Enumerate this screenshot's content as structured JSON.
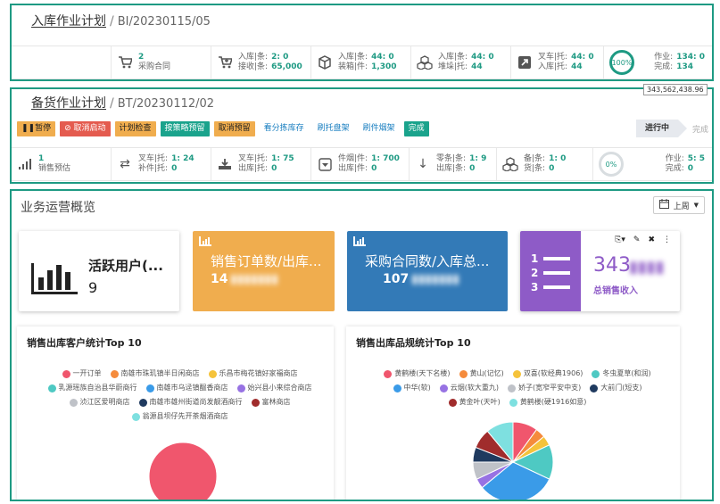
{
  "inbound": {
    "title": "入库作业计划",
    "code": "BI/20230115/05",
    "stats": [
      {
        "icon": "cart-icon",
        "lines": [
          {
            "label": "",
            "value": "2"
          },
          {
            "label": "采购合同",
            "value": ""
          }
        ]
      },
      {
        "icon": "cart-plus-icon",
        "lines": [
          {
            "label": "入库|条:",
            "value": "2: 0"
          },
          {
            "label": "接收|条:",
            "value": "65,000"
          }
        ]
      },
      {
        "icon": "cube-icon",
        "lines": [
          {
            "label": "入库|条:",
            "value": "44: 0"
          },
          {
            "label": "装箱|件:",
            "value": "1,300"
          }
        ]
      },
      {
        "icon": "cubes-icon",
        "lines": [
          {
            "label": "入库|条:",
            "value": "44: 0"
          },
          {
            "label": "堆垛|托:",
            "value": "44"
          }
        ]
      },
      {
        "icon": "forklift-icon",
        "lines": [
          {
            "label": "叉车|托:",
            "value": "44: 0"
          },
          {
            "label": "入库|托:",
            "value": "44"
          }
        ]
      },
      {
        "icon": "progress-ring",
        "ring": "100%",
        "lines": [
          {
            "label": "作业:",
            "value": "134: 0"
          },
          {
            "label": "完成:",
            "value": "134"
          }
        ]
      }
    ]
  },
  "picking": {
    "title": "备货作业计划",
    "code": "BT/20230112/02",
    "buttons": [
      {
        "label": "暂停",
        "icon": "pause-icon",
        "style": "orange"
      },
      {
        "label": "取消启动",
        "icon": "cancel-icon",
        "style": "red"
      },
      {
        "label": "计划检查",
        "style": "orange"
      },
      {
        "label": "按策略预留",
        "style": "teal"
      },
      {
        "label": "取消预留",
        "style": "orange"
      },
      {
        "label": "看分拣库存",
        "style": "link"
      },
      {
        "label": "刷托盘架",
        "style": "link"
      },
      {
        "label": "刷件烟架",
        "style": "link"
      },
      {
        "label": "完成",
        "style": "teal"
      }
    ],
    "status_active": "进行中",
    "status_next": "完成",
    "stats": [
      {
        "icon": "signal-bars-icon",
        "lines": [
          {
            "label": "",
            "value": "1"
          },
          {
            "label": "销售预估",
            "value": ""
          }
        ]
      },
      {
        "icon": "exchange-icon",
        "lines": [
          {
            "label": "叉车|托:",
            "value": "1: 24"
          },
          {
            "label": "补件|托:",
            "value": "0"
          }
        ]
      },
      {
        "icon": "download-icon",
        "lines": [
          {
            "label": "叉车|托:",
            "value": "1: 75"
          },
          {
            "label": "出库|托:",
            "value": "0"
          }
        ]
      },
      {
        "icon": "box-down-icon",
        "lines": [
          {
            "label": "件烟|件:",
            "value": "1: 700"
          },
          {
            "label": "出库|件:",
            "value": "0"
          }
        ]
      },
      {
        "icon": "arrow-down-icon",
        "lines": [
          {
            "label": "零条|条:",
            "value": "1: 9"
          },
          {
            "label": "出库|条:",
            "value": "0"
          }
        ]
      },
      {
        "icon": "cubes-icon",
        "lines": [
          {
            "label": "备|条:",
            "value": "1: 0"
          },
          {
            "label": "货|条:",
            "value": "0"
          }
        ]
      },
      {
        "icon": "progress-ring",
        "ring": "0%",
        "lines": [
          {
            "label": "作业:",
            "value": "5: 5"
          },
          {
            "label": "完成:",
            "value": "0"
          }
        ]
      }
    ]
  },
  "overview": {
    "title": "业务运营概览",
    "period": "上周",
    "cards": [
      {
        "title": "活跃用户(...",
        "value": "9"
      },
      {
        "title": "销售订单数/出库...",
        "value": "14"
      },
      {
        "title": "采购合同数/入库总...",
        "value": "107"
      },
      {
        "title": "总销售收入",
        "value": "343"
      }
    ],
    "tooltip": "343,562,438.96",
    "customer_chart": {
      "title": "销售出库客户统计Top 10",
      "legend": [
        {
          "name": "一开订单",
          "color": "#f0566d"
        },
        {
          "name": "南雄市珠玑镇半日闲商店",
          "color": "#f58b3c"
        },
        {
          "name": "乐昌市梅花镇好家福商店",
          "color": "#f5c33b"
        },
        {
          "name": "乳源瑶族自治县华蔚商行",
          "color": "#4ec9c3"
        },
        {
          "name": "南雄市乌迳镇醖香商店",
          "color": "#3a9be8"
        },
        {
          "name": "始兴县小来综合商店",
          "color": "#9772e3"
        },
        {
          "name": "浈江区爱明商店",
          "color": "#bfc2c8"
        },
        {
          "name": "南雄市雄州街道尚发靓酒商行",
          "color": "#1f3a5f"
        },
        {
          "name": "富林商店",
          "color": "#a02c2c"
        },
        {
          "name": "翁源县坝仔先开茶烟酒商店",
          "color": "#7ee0e0"
        }
      ]
    },
    "product_chart": {
      "title": "销售出库品规统计Top 10",
      "legend": [
        {
          "name": "黄鹤楼(天下名楼)",
          "color": "#f0566d"
        },
        {
          "name": "黄山(记忆)",
          "color": "#f58b3c"
        },
        {
          "name": "双喜(软经典1906)",
          "color": "#f5c33b"
        },
        {
          "name": "冬虫夏草(和润)",
          "color": "#4ec9c3"
        },
        {
          "name": "中华(软)",
          "color": "#3a9be8"
        },
        {
          "name": "云烟(软大重九)",
          "color": "#9772e3"
        },
        {
          "name": "娇子(宽窄平安中支)",
          "color": "#bfc2c8"
        },
        {
          "name": "大前门(短支)",
          "color": "#1f3a5f"
        },
        {
          "name": "黄金叶(天叶)",
          "color": "#a02c2c"
        },
        {
          "name": "黄鹤楼(硬1916如意)",
          "color": "#7ee0e0"
        }
      ]
    }
  },
  "chart_data": [
    {
      "type": "pie",
      "title": "销售出库客户统计Top 10",
      "categories": [
        "一开订单"
      ],
      "values": [
        100
      ]
    },
    {
      "type": "pie",
      "title": "销售出库品规统计Top 10",
      "categories": [
        "黄鹤楼(天下名楼)",
        "黄山(记忆)",
        "双喜(软经典1906)",
        "冬虫夏草(和润)",
        "中华(软)",
        "云烟(软大重九)",
        "娇子(宽窄平安中支)",
        "大前门(短支)",
        "黄金叶(天叶)",
        "黄鹤楼(硬1916如意)"
      ],
      "values": [
        10,
        4,
        4,
        14,
        32,
        4,
        7,
        6,
        8,
        11
      ]
    }
  ]
}
